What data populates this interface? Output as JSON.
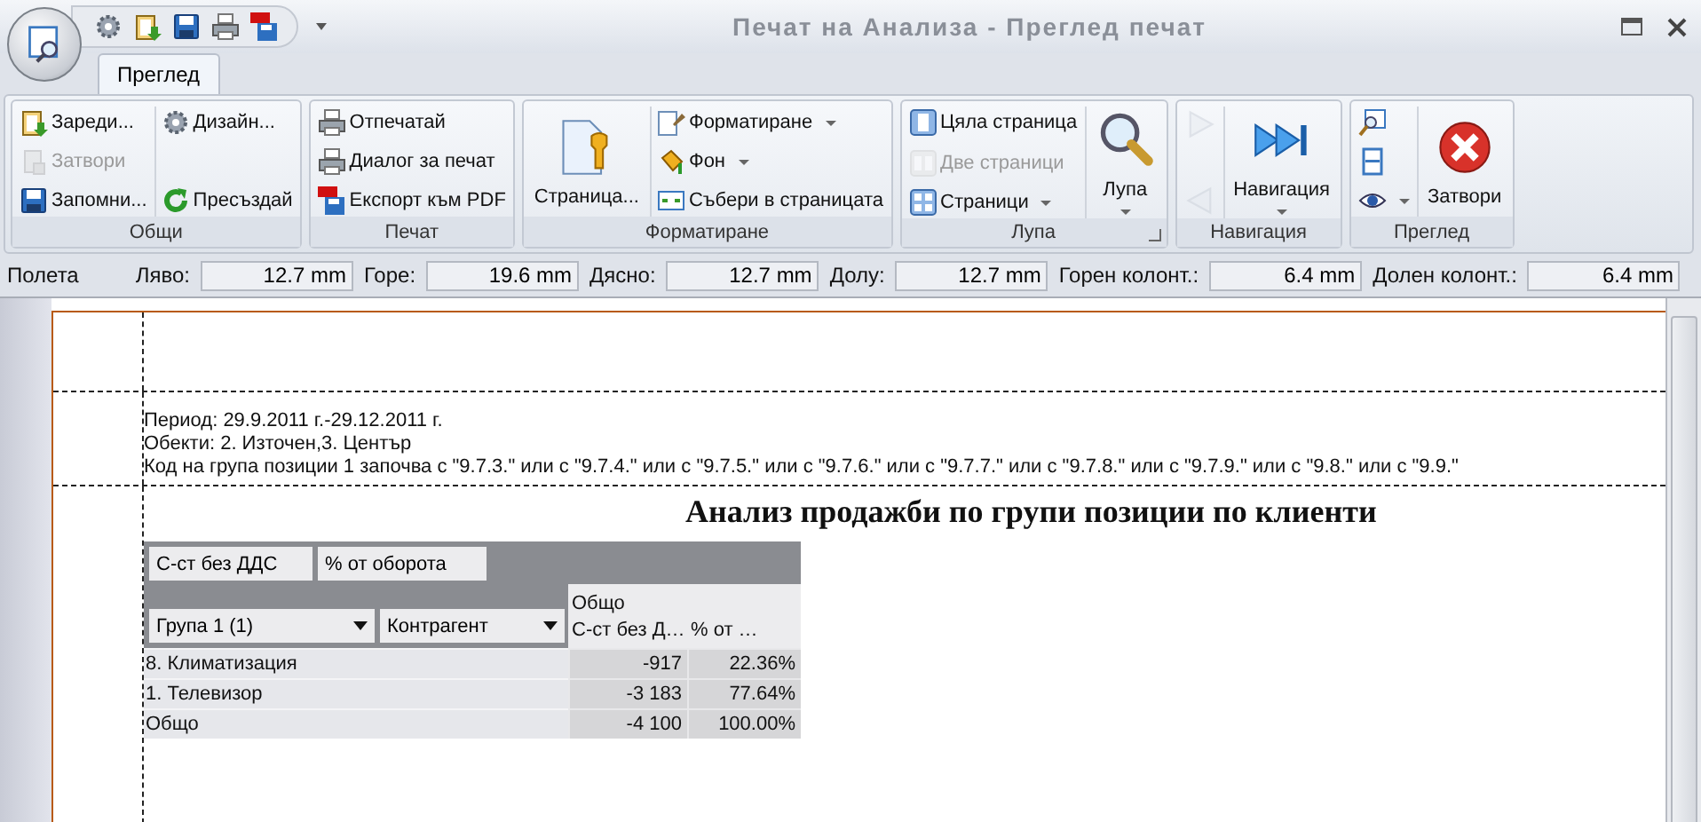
{
  "window": {
    "title": "Печат на Анализа - Преглед печат"
  },
  "tabs": [
    {
      "label": "Преглед",
      "selected": true
    }
  ],
  "ribbon": [
    {
      "title": "Общи",
      "columns": [
        [
          {
            "kind": "small",
            "label": "Зареди...",
            "disabled": false
          },
          {
            "kind": "small",
            "label": "Затвори",
            "disabled": true
          },
          {
            "kind": "small",
            "label": "Запомни...",
            "disabled": false
          }
        ],
        [
          {
            "kind": "small",
            "label": "Дизайн...",
            "disabled": false
          },
          {
            "kind": "small",
            "label": "Пресъздай",
            "disabled": false
          }
        ]
      ]
    },
    {
      "title": "Печат",
      "columns": [
        [
          {
            "kind": "small",
            "label": "Отпечатай",
            "disabled": false
          },
          {
            "kind": "small",
            "label": "Диалог за печат",
            "disabled": false
          },
          {
            "kind": "small",
            "label": "Експорт към PDF",
            "disabled": false
          }
        ]
      ]
    },
    {
      "title": "Форматиране",
      "columns": [
        [
          {
            "kind": "large",
            "label": "Страница...",
            "disabled": false,
            "dropdown": false
          }
        ],
        [
          {
            "kind": "small",
            "label": "Форматиране",
            "disabled": false,
            "dropdown": true
          },
          {
            "kind": "small",
            "label": "Фон",
            "disabled": false,
            "dropdown": true
          },
          {
            "kind": "small",
            "label": "Събери в страницата",
            "disabled": false
          }
        ]
      ]
    },
    {
      "title": "Лупа",
      "launcher": true,
      "columns": [
        [
          {
            "kind": "small",
            "label": "Цяла страница",
            "disabled": false
          },
          {
            "kind": "small",
            "label": "Две страници",
            "disabled": true
          },
          {
            "kind": "small",
            "label": "Страници",
            "disabled": false,
            "dropdown": true
          }
        ],
        [
          {
            "kind": "large",
            "label": "Лупа",
            "disabled": false,
            "dropdown": true
          }
        ]
      ]
    },
    {
      "title": "Навигация",
      "columns": [
        [
          {
            "kind": "icon",
            "disabled": true
          },
          {
            "kind": "icon",
            "disabled": true
          }
        ],
        [
          {
            "kind": "large",
            "label": "Навигация",
            "disabled": false,
            "dropdown": true
          }
        ]
      ]
    },
    {
      "title": "Преглед",
      "columns": [
        [
          {
            "kind": "icon",
            "disabled": false
          },
          {
            "kind": "icon",
            "disabled": false
          },
          {
            "kind": "icon",
            "disabled": false,
            "dropdown": true
          }
        ],
        [
          {
            "kind": "large",
            "label": "Затвори",
            "disabled": false,
            "dropdown": false
          }
        ]
      ]
    }
  ],
  "margins": {
    "label": "Полета",
    "fields": [
      {
        "label": "Ляво:",
        "value": "12.7 mm"
      },
      {
        "label": "Горе:",
        "value": "19.6 mm"
      },
      {
        "label": "Дясно:",
        "value": "12.7 mm"
      },
      {
        "label": "Долу:",
        "value": "12.7 mm"
      },
      {
        "label": "Горен колонт.:",
        "value": "6.4 mm"
      },
      {
        "label": "Долен колонт.:",
        "value": "6.4 mm"
      }
    ]
  },
  "report": {
    "header_lines": [
      "Период: 29.9.2011 г.-29.12.2011 г.",
      "Обекти: 2. Източен,3. Център",
      "Код на група позиции 1 започва с \"9.7.3.\" или с \"9.7.4.\" или с \"9.7.5.\" или с \"9.7.6.\" или с \"9.7.7.\" или с \"9.7.8.\" или с \"9.7.9.\" или с \"9.8.\" или с \"9.9.\""
    ],
    "title": "Анализ продажби по групи позиции по клиенти",
    "pivot": {
      "data_fields": [
        "С-ст без ДДС",
        "% от оборота"
      ],
      "row_fields": [
        {
          "label": "Група 1 (1)"
        },
        {
          "label": "Контрагент"
        }
      ],
      "column_header": "Общо",
      "data_headers": [
        "С-ст без Д…",
        "% от …"
      ],
      "rows": [
        {
          "label": "8. Климатизация",
          "values": [
            "-917",
            "22.36%"
          ]
        },
        {
          "label": "1. Телевизор",
          "values": [
            "-3 183",
            "77.64%"
          ]
        },
        {
          "label": "Общо",
          "values": [
            "-4 100",
            "100.00%"
          ]
        }
      ]
    }
  }
}
